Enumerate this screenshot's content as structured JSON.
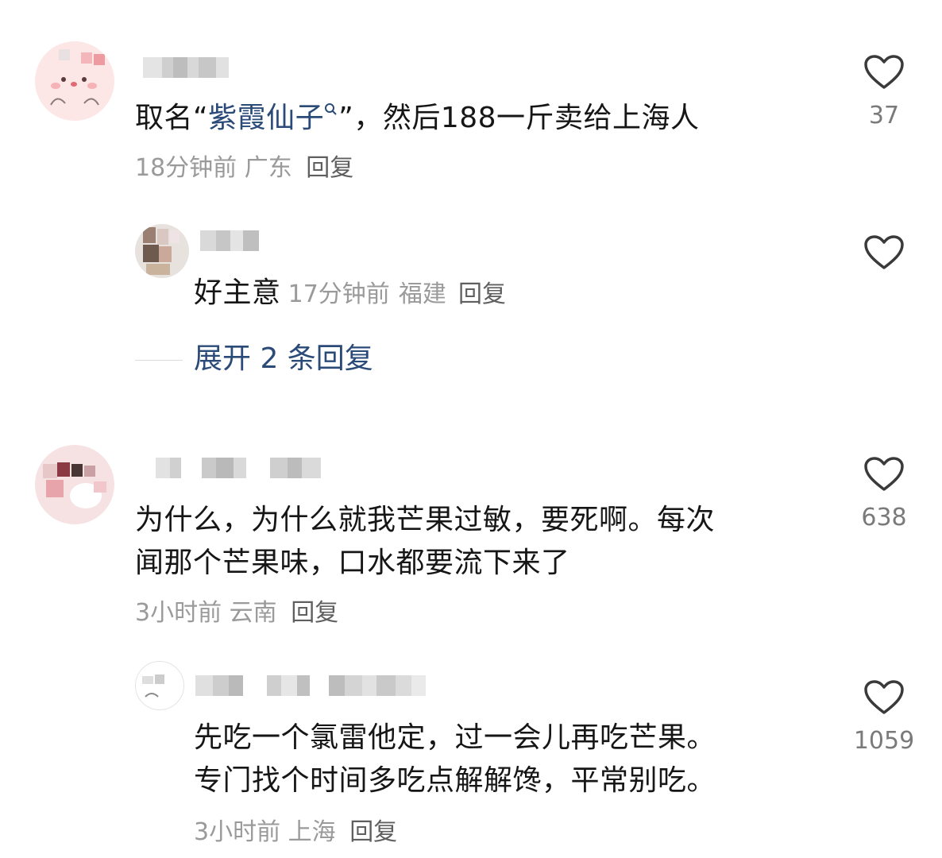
{
  "comments": [
    {
      "text_before": "取名“",
      "highlight": "紫霞仙子",
      "highlight_icon": "search-icon",
      "text_after": "”，然后188一斤卖给上海人",
      "time": "18分钟前",
      "location": "广东",
      "reply_label": "回复",
      "likes": "37"
    },
    {
      "text": "为什么，为什么就我芒果过敏，要死啊。每次闻那个芒果味，口水都要流下来了",
      "line1": "为什么，为什么就我芒果过敏，要死啊。每次",
      "line2": "闻那个芒果味，口水都要流下来了",
      "time": "3小时前",
      "location": "云南",
      "reply_label": "回复",
      "likes": "638"
    }
  ],
  "replies": [
    {
      "text": "好主意",
      "time": "17分钟前",
      "location": "福建",
      "reply_label": "回复"
    },
    {
      "line1": "先吃一个氯雷他定，过一会儿再吃芒果。",
      "line2": "专门找个时间多吃点解解馋，平常别吃。",
      "time": "3小时前",
      "location": "上海",
      "reply_label": "回复",
      "likes": "1059"
    }
  ],
  "expand": {
    "label": "展开 2 条回复"
  },
  "icons": {
    "like": "heart-outline-icon"
  },
  "colors": {
    "link": "#2a4a78",
    "meta": "#9a9a9a",
    "text": "#161616"
  }
}
